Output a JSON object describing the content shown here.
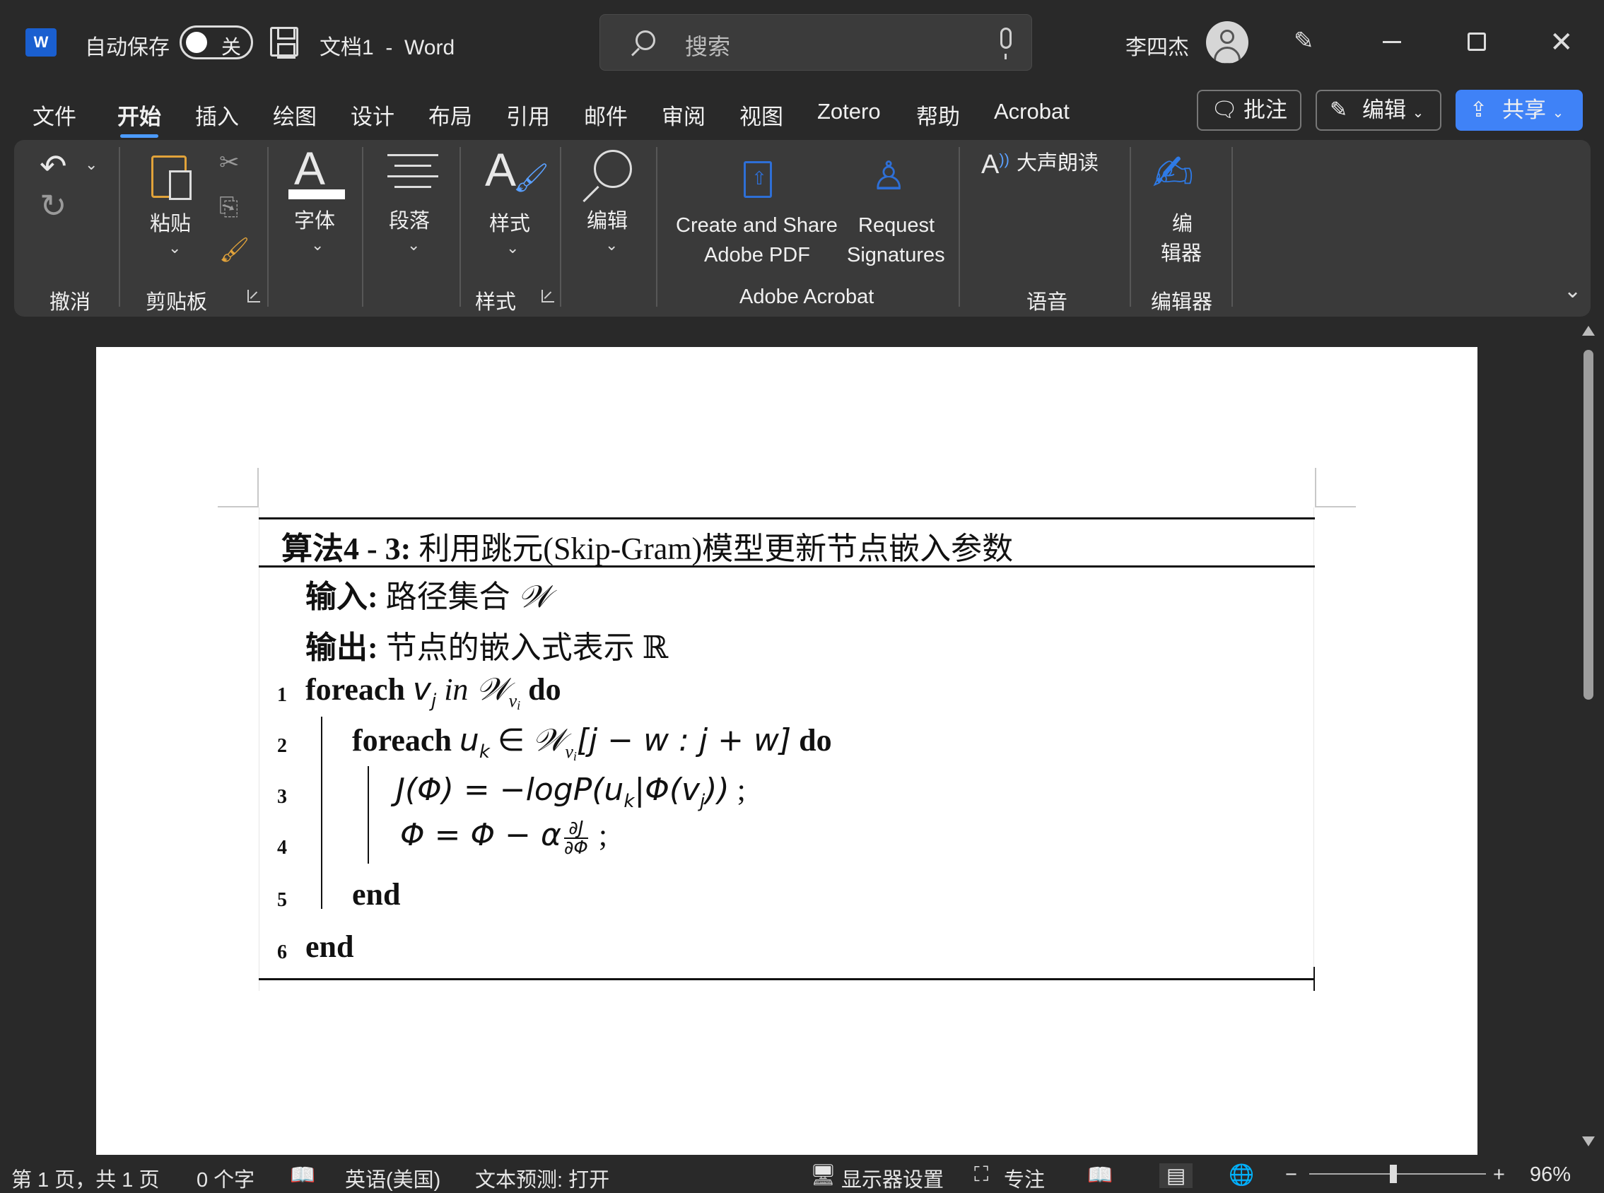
{
  "titlebar": {
    "autosave_label": "自动保存",
    "autosave_state": "关",
    "doc_title": "文档1  -  Word",
    "search_placeholder": "搜索",
    "user_name": "李四杰"
  },
  "tabs": [
    "文件",
    "开始",
    "插入",
    "绘图",
    "设计",
    "布局",
    "引用",
    "邮件",
    "审阅",
    "视图",
    "Zotero",
    "帮助",
    "Acrobat"
  ],
  "active_tab": "开始",
  "actions": {
    "comments": "批注",
    "editing": "编辑",
    "share": "共享"
  },
  "ribbon": {
    "paste": "粘贴",
    "font": "字体",
    "paragraph": "段落",
    "styles": "样式",
    "editing": "编辑",
    "create_pdf_1": "Create and Share",
    "create_pdf_2": "Adobe PDF",
    "request_sig_1": "Request",
    "request_sig_2": "Signatures",
    "read_aloud": "大声朗读",
    "editor_1": "编",
    "editor_2": "辑器",
    "groups": {
      "undo": "撤消",
      "clipboard": "剪贴板",
      "styles": "样式",
      "acrobat": "Adobe Acrobat",
      "voice": "语音",
      "editor": "编辑器"
    }
  },
  "algorithm": {
    "caption_label": "算法4 - 3:",
    "caption_text": "利用跳元(Skip-Gram)模型更新节点嵌入参数",
    "input_label": "输入:",
    "input_text": "路径集合",
    "output_label": "输出:",
    "output_text": "节点的嵌入式表示",
    "kw_foreach": "foreach",
    "kw_in": "in",
    "kw_do": "do",
    "kw_end": "end",
    "line_numbers": [
      "1",
      "2",
      "3",
      "4",
      "5",
      "6"
    ]
  },
  "statusbar": {
    "page": "第 1 页，共 1 页",
    "words": "0 个字",
    "language": "英语(美国)",
    "prediction": "文本预测: 打开",
    "display": "显示器设置",
    "focus": "专注",
    "zoom": "96%"
  }
}
